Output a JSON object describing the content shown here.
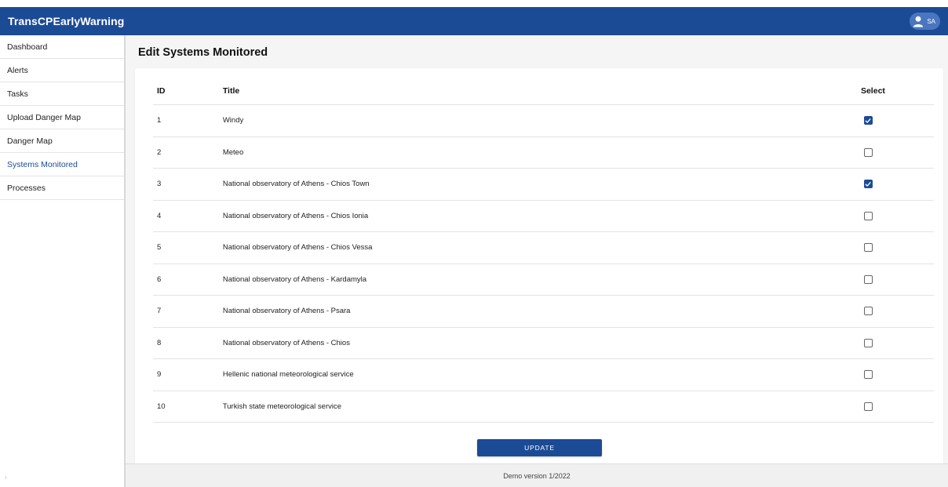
{
  "app": {
    "title": "TransCPEarlyWarning",
    "user_initials": "SA",
    "accent_color": "#1c4b96"
  },
  "sidebar": {
    "items": [
      {
        "label": "Dashboard",
        "active": false
      },
      {
        "label": "Alerts",
        "active": false
      },
      {
        "label": "Tasks",
        "active": false
      },
      {
        "label": "Upload Danger Map",
        "active": false
      },
      {
        "label": "Danger Map",
        "active": false
      },
      {
        "label": "Systems Monitored",
        "active": true
      },
      {
        "label": "Processes",
        "active": false
      }
    ]
  },
  "main": {
    "page_title": "Edit Systems Monitored",
    "table": {
      "columns": {
        "id": "ID",
        "title": "Title",
        "select": "Select"
      },
      "rows": [
        {
          "id": "1",
          "title": "Windy",
          "selected": true
        },
        {
          "id": "2",
          "title": "Meteo",
          "selected": false
        },
        {
          "id": "3",
          "title": "National observatory of Athens - Chios Town",
          "selected": true
        },
        {
          "id": "4",
          "title": "National observatory of Athens - Chios Ionia",
          "selected": false
        },
        {
          "id": "5",
          "title": "National observatory of Athens - Chios Vessa",
          "selected": false
        },
        {
          "id": "6",
          "title": "National observatory of Athens - Kardamyla",
          "selected": false
        },
        {
          "id": "7",
          "title": "National observatory of Athens - Psara",
          "selected": false
        },
        {
          "id": "8",
          "title": "National observatory of Athens - Chios",
          "selected": false
        },
        {
          "id": "9",
          "title": "Hellenic national meteorological service",
          "selected": false
        },
        {
          "id": "10",
          "title": "Turkish state meteorological service",
          "selected": false
        }
      ]
    },
    "update_label": "UPDATE"
  },
  "footer": {
    "text": "Demo version 1/2022"
  }
}
